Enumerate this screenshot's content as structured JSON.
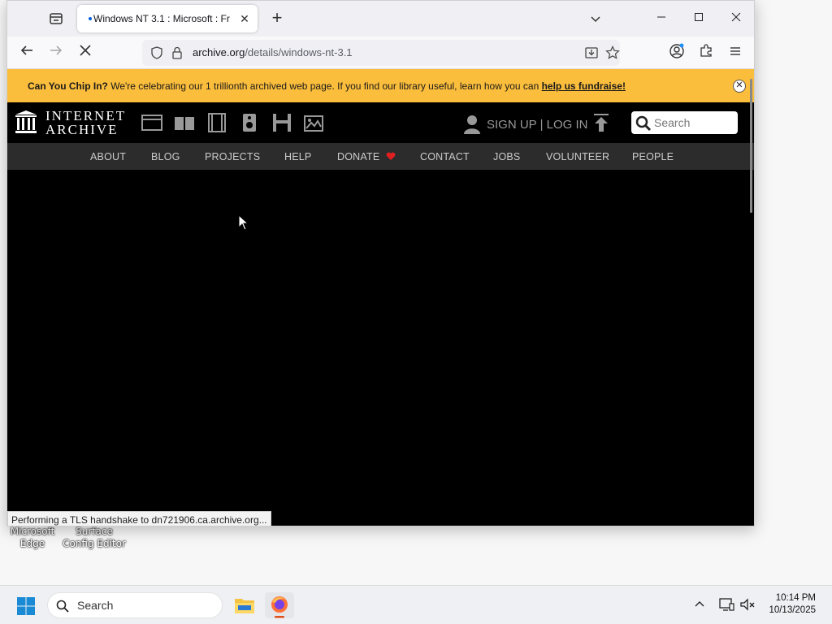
{
  "browser": {
    "tab_title": "Windows NT 3.1 : Microsoft : Fr",
    "url_domain": "archive.org",
    "url_path": "/details/windows-nt-3.1",
    "status_text": "Performing a TLS handshake to dn721906.ca.archive.org..."
  },
  "banner": {
    "bold_text": "Can You Chip In?",
    "text": " We're celebrating our 1 trillionth archived web page. If you find our library useful, learn how you can ",
    "link_text": "help us fundraise!"
  },
  "ia_header": {
    "logo_line1": "INTERNET",
    "logo_line2": "ARCHIVE",
    "signin": "SIGN UP | LOG IN",
    "search_placeholder": "Search",
    "nav": [
      "ABOUT",
      "BLOG",
      "PROJECTS",
      "HELP",
      "DONATE",
      "CONTACT",
      "JOBS",
      "VOLUNTEER",
      "PEOPLE"
    ]
  },
  "desktop": {
    "icons": [
      {
        "label_line1": "Microsoft",
        "label_line2": "Edge"
      },
      {
        "label_line1": "Surface",
        "label_line2": "Config Editor"
      }
    ]
  },
  "taskbar": {
    "search_placeholder": "Search",
    "time": "10:14 PM",
    "date": "10/13/2025"
  },
  "colors": {
    "banner": "#fbbd3c",
    "ia_black": "#000000",
    "ia_nav": "#2c2c2c",
    "donate_heart": "#e02020"
  }
}
